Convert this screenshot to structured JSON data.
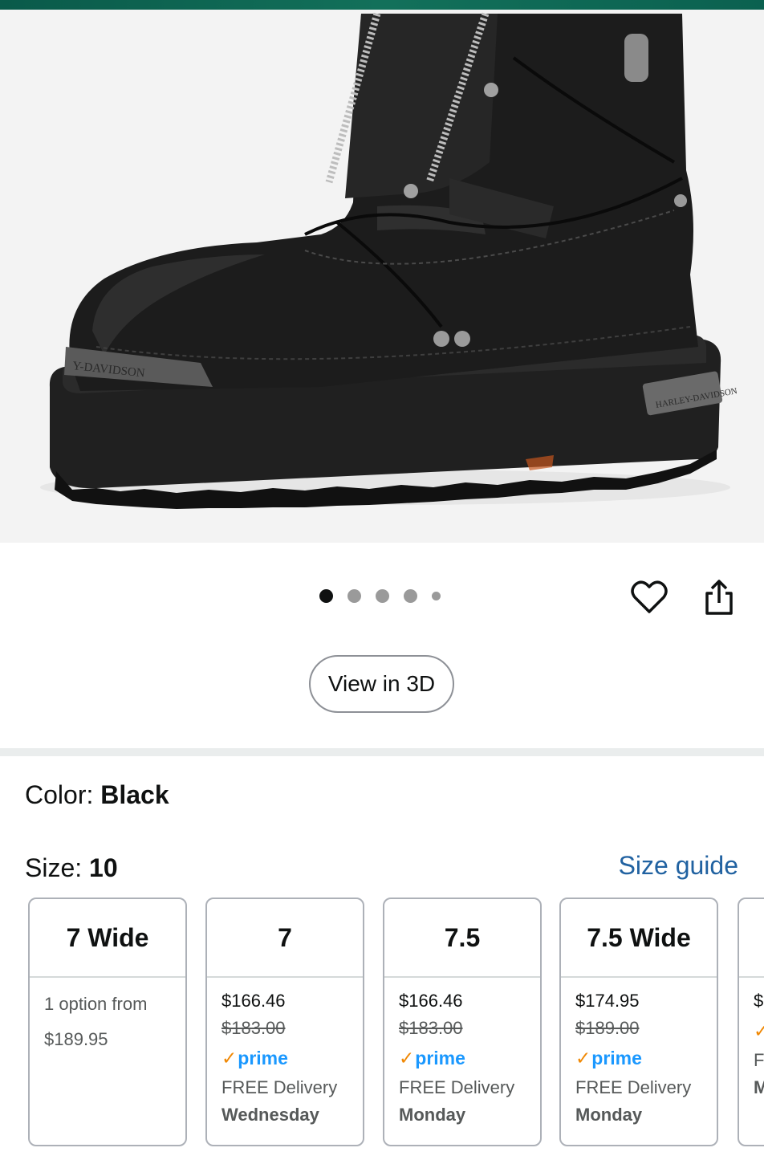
{
  "product": {
    "image_alt": "Black leather motorcycle boot with front zippers and laces",
    "brand_plate_text": "HARLEY-DAVIDSON",
    "toe_plate_text": "Y-DAVIDSON"
  },
  "gallery": {
    "dots_count": 5,
    "active_index": 0,
    "view_3d_label": "View in 3D"
  },
  "color": {
    "label": "Color: ",
    "value": "Black"
  },
  "size": {
    "label": "Size: ",
    "value": "10",
    "guide_label": "Size guide"
  },
  "size_options": [
    {
      "size": "7 Wide",
      "line1": "1 option from",
      "line2": "$189.95"
    },
    {
      "size": "7",
      "price": "$166.46",
      "list_price": "$183.00",
      "prime": "prime",
      "delivery": "FREE Delivery",
      "day": "Wednesday"
    },
    {
      "size": "7.5",
      "price": "$166.46",
      "list_price": "$183.00",
      "prime": "prime",
      "delivery": "FREE Delivery",
      "day": "Monday"
    },
    {
      "size": "7.5 Wide",
      "price": "$174.95",
      "list_price": "$189.00",
      "prime": "prime",
      "delivery": "FREE Delivery",
      "day": "Monday"
    },
    {
      "size": "",
      "price": "$",
      "list_price": "",
      "prime": "",
      "delivery": "F",
      "day": "M"
    }
  ],
  "icons": {
    "favorite": "heart-icon",
    "share": "share-icon",
    "prime_check": "check-icon"
  },
  "colors": {
    "link": "#2162a1",
    "prime_blue": "#1a98ff",
    "prime_orange": "#f08804",
    "top_bar": "#0b6150"
  }
}
